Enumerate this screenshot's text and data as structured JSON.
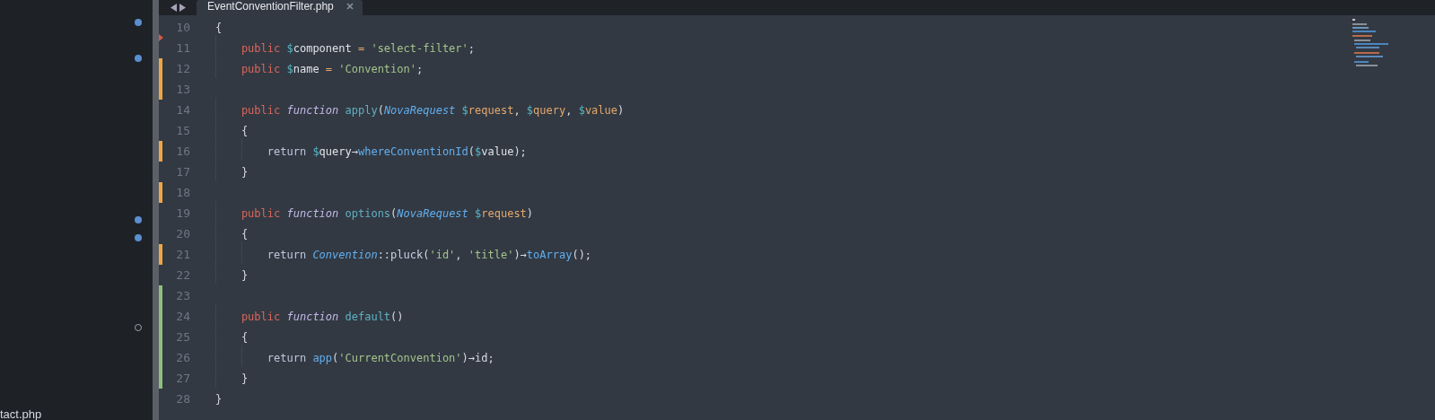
{
  "sidebar": {
    "rows": [
      {
        "kind": "modified"
      },
      {
        "kind": "plain"
      },
      {
        "kind": "modified"
      },
      {
        "kind": "plain"
      },
      {
        "kind": "plain"
      },
      {
        "kind": "plain"
      },
      {
        "kind": "plain"
      },
      {
        "kind": "plain"
      },
      {
        "kind": "plain"
      },
      {
        "kind": "plain"
      },
      {
        "kind": "plain"
      },
      {
        "kind": "modified"
      },
      {
        "kind": "modified"
      },
      {
        "kind": "plain"
      },
      {
        "kind": "plain"
      },
      {
        "kind": "plain"
      },
      {
        "kind": "plain"
      },
      {
        "kind": "open"
      },
      {
        "kind": "plain"
      },
      {
        "kind": "plain"
      },
      {
        "kind": "plain"
      },
      {
        "kind": "plain"
      },
      {
        "kind": "plain",
        "label": "tact.php"
      }
    ]
  },
  "tabs": [
    {
      "label": "EventConventionFilter.php",
      "selected": true
    }
  ],
  "editor": {
    "lines": [
      {
        "number": "10",
        "bookmark": false,
        "tokens": [
          {
            "kind": "punct",
            "text": "{"
          }
        ]
      },
      {
        "number": "11",
        "bookmark": true,
        "tokens": [
          {
            "kind": "kw",
            "text": "    public "
          },
          {
            "kind": "sig",
            "text": "$"
          },
          {
            "kind": "var",
            "text": "component "
          },
          {
            "kind": "op",
            "text": "= "
          },
          {
            "kind": "str",
            "text": "'select-filter'"
          },
          {
            "kind": "punct",
            "text": ";"
          }
        ]
      },
      {
        "number": "12",
        "color": "#f0a545",
        "bookmark": false,
        "tokens": [
          {
            "kind": "kw",
            "text": "    public "
          },
          {
            "kind": "sig",
            "text": "$"
          },
          {
            "kind": "var",
            "text": "name "
          },
          {
            "kind": "op",
            "text": "= "
          },
          {
            "kind": "str",
            "text": "'Convention'"
          },
          {
            "kind": "punct",
            "text": ";"
          }
        ]
      },
      {
        "number": "13",
        "color": "#f0a545",
        "bookmark": false
      },
      {
        "number": "14",
        "bookmark": false,
        "tokens": [
          {
            "kind": "kw",
            "text": "    public "
          },
          {
            "kind": "storage",
            "text": "function "
          },
          {
            "kind": "fn",
            "text": "apply"
          },
          {
            "kind": "punct",
            "text": "("
          },
          {
            "kind": "cls",
            "text": "NovaRequest "
          },
          {
            "kind": "sig",
            "text": "$"
          },
          {
            "kind": "param",
            "text": "request"
          },
          {
            "kind": "punct",
            "text": ", "
          },
          {
            "kind": "sig",
            "text": "$"
          },
          {
            "kind": "param",
            "text": "query"
          },
          {
            "kind": "punct",
            "text": ", "
          },
          {
            "kind": "sig",
            "text": "$"
          },
          {
            "kind": "param",
            "text": "value"
          },
          {
            "kind": "punct",
            "text": ")"
          }
        ]
      },
      {
        "number": "15",
        "bookmark": false,
        "tokens": [
          {
            "kind": "punct",
            "text": "    {"
          }
        ]
      },
      {
        "number": "16",
        "color": "#f0a545",
        "bookmark": false,
        "tokens": [
          {
            "kind": "ret",
            "text": "        return "
          },
          {
            "kind": "sig",
            "text": "$"
          },
          {
            "kind": "var",
            "text": "query"
          },
          {
            "kind": "punct",
            "text": "→"
          },
          {
            "kind": "method",
            "text": "whereConventionId"
          },
          {
            "kind": "punct",
            "text": "("
          },
          {
            "kind": "sig",
            "text": "$"
          },
          {
            "kind": "var",
            "text": "value"
          },
          {
            "kind": "punct",
            "text": ");"
          }
        ]
      },
      {
        "number": "17",
        "bookmark": false,
        "tokens": [
          {
            "kind": "punct",
            "text": "    }"
          }
        ]
      },
      {
        "number": "18",
        "color": "#f0a545",
        "bookmark": false
      },
      {
        "number": "19",
        "bookmark": false,
        "tokens": [
          {
            "kind": "kw",
            "text": "    public "
          },
          {
            "kind": "storage",
            "text": "function "
          },
          {
            "kind": "fn",
            "text": "options"
          },
          {
            "kind": "punct",
            "text": "("
          },
          {
            "kind": "cls",
            "text": "NovaRequest "
          },
          {
            "kind": "sig",
            "text": "$"
          },
          {
            "kind": "param",
            "text": "request"
          },
          {
            "kind": "punct",
            "text": ")"
          }
        ]
      },
      {
        "number": "20",
        "bookmark": false,
        "tokens": [
          {
            "kind": "punct",
            "text": "    {"
          }
        ]
      },
      {
        "number": "21",
        "color": "#f0a545",
        "bookmark": false,
        "tokens": [
          {
            "kind": "ret",
            "text": "        return "
          },
          {
            "kind": "cls",
            "text": "Convention"
          },
          {
            "kind": "punct",
            "text": "::"
          },
          {
            "kind": "call",
            "text": "pluck"
          },
          {
            "kind": "punct",
            "text": "("
          },
          {
            "kind": "str",
            "text": "'id'"
          },
          {
            "kind": "punct",
            "text": ", "
          },
          {
            "kind": "str",
            "text": "'title'"
          },
          {
            "kind": "punct",
            "text": ")→"
          },
          {
            "kind": "method",
            "text": "toArray"
          },
          {
            "kind": "punct",
            "text": "();"
          }
        ]
      },
      {
        "number": "22",
        "bookmark": false,
        "tokens": [
          {
            "kind": "punct",
            "text": "    }"
          }
        ]
      },
      {
        "number": "23",
        "color": "#8dc07c",
        "bookmark": false
      },
      {
        "number": "24",
        "color": "#8dc07c",
        "bookmark": false,
        "tokens": [
          {
            "kind": "kw",
            "text": "    public "
          },
          {
            "kind": "storage",
            "text": "function "
          },
          {
            "kind": "fn",
            "text": "default"
          },
          {
            "kind": "punct",
            "text": "()"
          }
        ]
      },
      {
        "number": "25",
        "color": "#8dc07c",
        "bookmark": false,
        "tokens": [
          {
            "kind": "punct",
            "text": "    {"
          }
        ]
      },
      {
        "number": "26",
        "color": "#8dc07c",
        "bookmark": false,
        "tokens": [
          {
            "kind": "ret",
            "text": "        return "
          },
          {
            "kind": "method",
            "text": "app"
          },
          {
            "kind": "punct",
            "text": "("
          },
          {
            "kind": "str",
            "text": "'CurrentConvention'"
          },
          {
            "kind": "punct",
            "text": ")→id;"
          }
        ]
      },
      {
        "number": "27",
        "color": "#8dc07c",
        "bookmark": false,
        "tokens": [
          {
            "kind": "punct",
            "text": "    }"
          }
        ]
      },
      {
        "number": "28",
        "bookmark": false,
        "tokens": [
          {
            "kind": "punct",
            "text": "}"
          }
        ]
      }
    ]
  }
}
